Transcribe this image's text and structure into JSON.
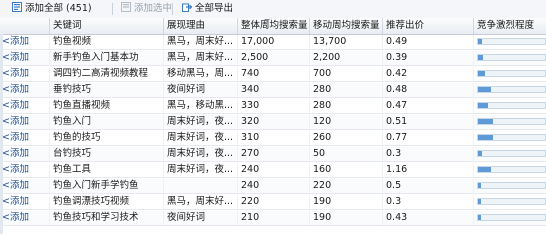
{
  "toolbar": {
    "add_all_label": "添加全部",
    "add_all_count": "(451)",
    "add_selected_label": "添加选中",
    "export_all_label": "全部导出"
  },
  "table": {
    "headers": {
      "action": "",
      "keyword": "关键词",
      "reason": "展现理由",
      "pc_volume": "整体周均搜索量",
      "mobile_volume": "移动周均搜索量",
      "bid": "推荐出价",
      "competition": "竞争激烈程度"
    },
    "rows": [
      {
        "action": "<添加",
        "keyword": "钓鱼视频",
        "reason": "黑马，周末好...",
        "pc_volume": "17,000",
        "mobile_volume": "13,700",
        "bid": "0.49",
        "competition": 0.06
      },
      {
        "action": "<添加",
        "keyword": "新手钓鱼入门基本功",
        "reason": "黑马，周末好...",
        "pc_volume": "2,500",
        "mobile_volume": "2,200",
        "bid": "0.39",
        "competition": 0.08
      },
      {
        "action": "<添加",
        "keyword": "调四钓二高清视频教程",
        "reason": "移动黑马，周...",
        "pc_volume": "740",
        "mobile_volume": "700",
        "bid": "0.42",
        "competition": 0.1
      },
      {
        "action": "<添加",
        "keyword": "垂钓技巧",
        "reason": "夜间好词",
        "pc_volume": "340",
        "mobile_volume": "280",
        "bid": "0.48",
        "competition": 0.2
      },
      {
        "action": "<添加",
        "keyword": "钓鱼直播视频",
        "reason": "黑马，移动黑...",
        "pc_volume": "330",
        "mobile_volume": "280",
        "bid": "0.47",
        "competition": 0.15
      },
      {
        "action": "<添加",
        "keyword": "钓鱼入门",
        "reason": "周末好词，夜...",
        "pc_volume": "320",
        "mobile_volume": "120",
        "bid": "0.51",
        "competition": 0.22
      },
      {
        "action": "<添加",
        "keyword": "钓鱼的技巧",
        "reason": "周末好词，夜...",
        "pc_volume": "310",
        "mobile_volume": "260",
        "bid": "0.77",
        "competition": 0.22
      },
      {
        "action": "<添加",
        "keyword": "台钓技巧",
        "reason": "周末好词，夜...",
        "pc_volume": "270",
        "mobile_volume": "50",
        "bid": "0.3",
        "competition": 0.06
      },
      {
        "action": "<添加",
        "keyword": "钓鱼工具",
        "reason": "周末好词，夜...",
        "pc_volume": "240",
        "mobile_volume": "160",
        "bid": "1.16",
        "competition": 0.2
      },
      {
        "action": "<添加",
        "keyword": "钓鱼入门新手学钓鱼",
        "reason": "",
        "pc_volume": "240",
        "mobile_volume": "220",
        "bid": "0.5",
        "competition": 0.05
      },
      {
        "action": "<添加",
        "keyword": "钓鱼调漂技巧视频",
        "reason": "黑马，周末好...",
        "pc_volume": "220",
        "mobile_volume": "190",
        "bid": "0.3",
        "competition": 0.05
      },
      {
        "action": "<添加",
        "keyword": "钓鱼技巧和学习技术",
        "reason": "夜间好词",
        "pc_volume": "210",
        "mobile_volume": "190",
        "bid": "0.43",
        "competition": 0.05
      }
    ]
  },
  "colors": {
    "link": "#1e4f9a",
    "bar_fill": "#5f9ad8",
    "bar_track": "#eef3f8",
    "header_bg": "#e9edf2"
  }
}
